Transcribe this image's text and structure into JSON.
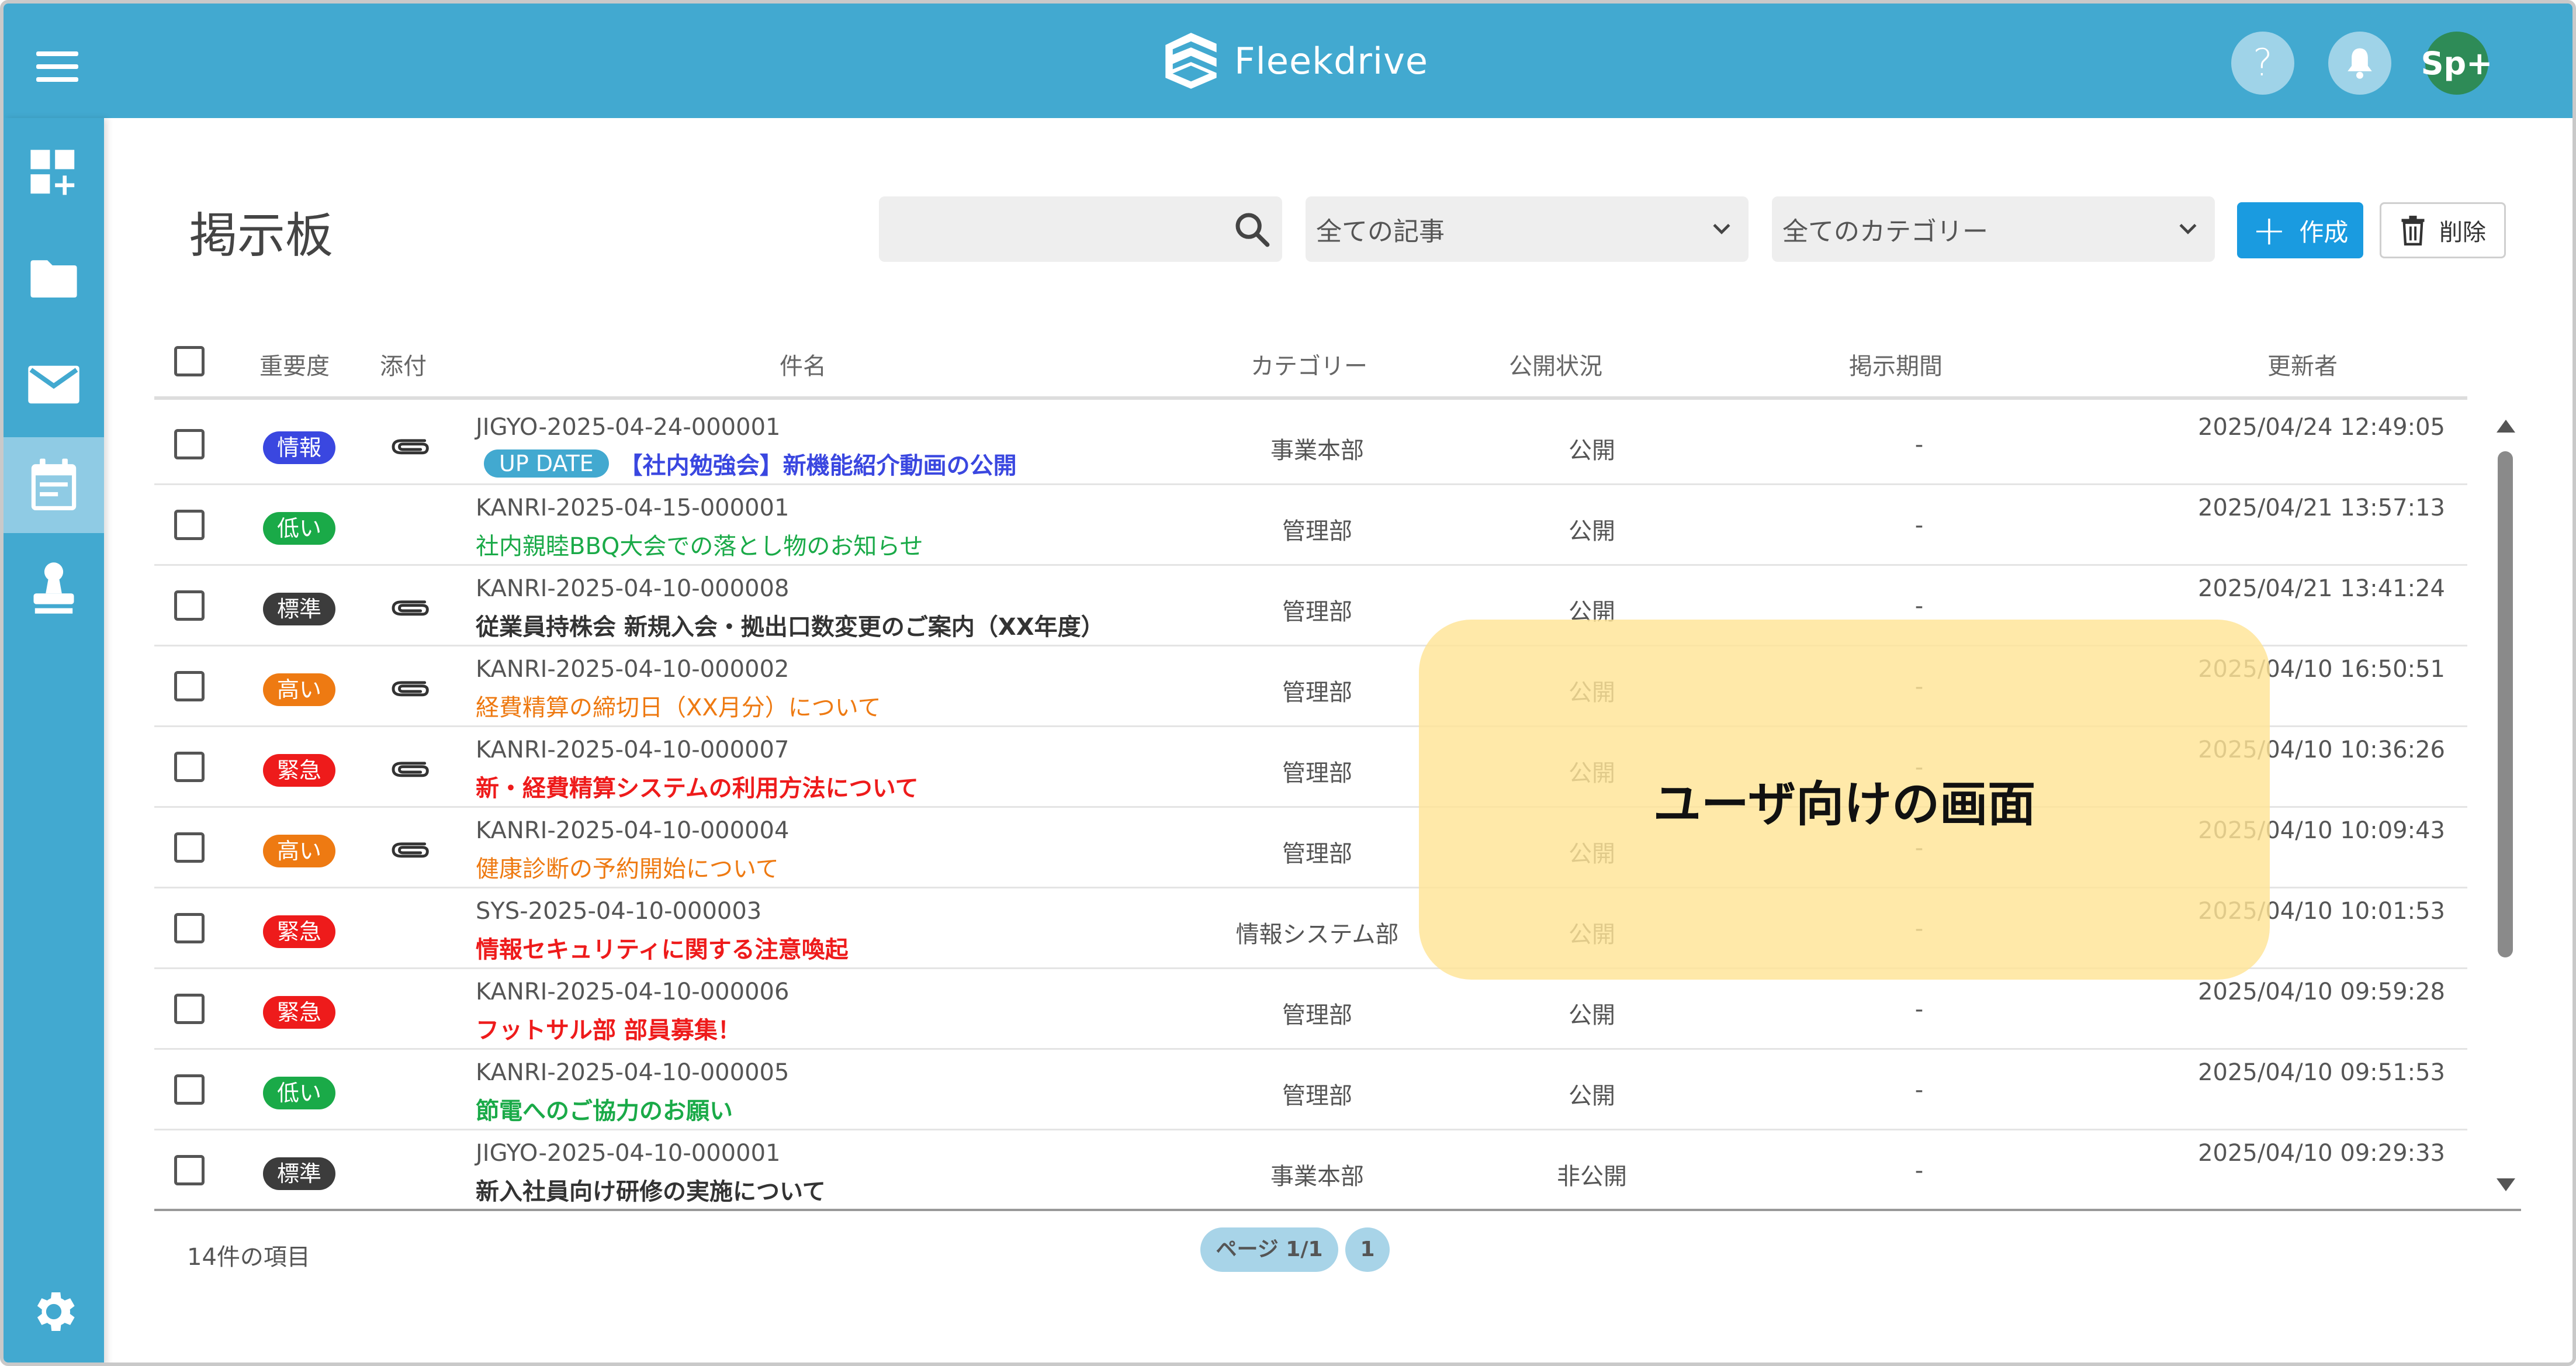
{
  "app": {
    "name": "Fleekdrive",
    "avatar_label": "Sp+",
    "help_label": "?"
  },
  "sidebar": {
    "items": [
      {
        "icon": "dashboard-add-icon"
      },
      {
        "icon": "folder-icon"
      },
      {
        "icon": "mail-icon"
      },
      {
        "icon": "calendar-board-icon",
        "active": true
      },
      {
        "icon": "stamp-icon"
      },
      {
        "icon": "gear-icon"
      }
    ]
  },
  "page": {
    "title": "掲示板",
    "search_placeholder": "",
    "filter_articles": "全ての記事",
    "filter_category": "全てのカテゴリー",
    "create_label": "作成",
    "delete_label": "削除"
  },
  "table": {
    "columns": {
      "priority": "重要度",
      "attachment": "添付",
      "subject": "件名",
      "category": "カテゴリー",
      "status": "公開状況",
      "period": "掲示期間",
      "updated_by": "更新者"
    },
    "rows": [
      {
        "priority": "情報",
        "priority_color": "#3a47e0",
        "attachment": true,
        "code": "JIGYO-2025-04-24-000001",
        "update_tag": "UP DATE",
        "title": "【社内勉強会】新機能紹介動画の公開",
        "title_color": "#3a47e0",
        "bold": true,
        "category": "事業本部",
        "status": "公開",
        "period": "-",
        "updated": "2025/04/24 12:49:05"
      },
      {
        "priority": "低い",
        "priority_color": "#1aaa48",
        "attachment": false,
        "code": "KANRI-2025-04-15-000001",
        "update_tag": "",
        "title": "社内親睦BBQ大会での落とし物のお知らせ",
        "title_color": "#1aaa48",
        "bold": false,
        "category": "管理部",
        "status": "公開",
        "period": "-",
        "updated": "2025/04/21 13:57:13"
      },
      {
        "priority": "標準",
        "priority_color": "#3c3c3c",
        "attachment": true,
        "code": "KANRI-2025-04-10-000008",
        "update_tag": "",
        "title": "従業員持株会 新規入会・拠出口数変更のご案内（XX年度）",
        "title_color": "#333333",
        "bold": true,
        "category": "管理部",
        "status": "公開",
        "period": "-",
        "updated": "2025/04/21 13:41:24"
      },
      {
        "priority": "高い",
        "priority_color": "#ee7a12",
        "attachment": true,
        "code": "KANRI-2025-04-10-000002",
        "update_tag": "",
        "title": "経費精算の締切日（XX月分）について",
        "title_color": "#ee7a12",
        "bold": false,
        "category": "管理部",
        "status": "公開",
        "period": "-",
        "updated": "2025/04/10 16:50:51"
      },
      {
        "priority": "緊急",
        "priority_color": "#ee1b1b",
        "attachment": true,
        "code": "KANRI-2025-04-10-000007",
        "update_tag": "",
        "title": "新・経費精算システムの利用方法について",
        "title_color": "#ee1b1b",
        "bold": true,
        "category": "管理部",
        "status": "公開",
        "period": "-",
        "updated": "2025/04/10 10:36:26"
      },
      {
        "priority": "高い",
        "priority_color": "#ee7a12",
        "attachment": true,
        "code": "KANRI-2025-04-10-000004",
        "update_tag": "",
        "title": "健康診断の予約開始について",
        "title_color": "#ee7a12",
        "bold": false,
        "category": "管理部",
        "status": "公開",
        "period": "-",
        "updated": "2025/04/10 10:09:43"
      },
      {
        "priority": "緊急",
        "priority_color": "#ee1b1b",
        "attachment": false,
        "code": "SYS-2025-04-10-000003",
        "update_tag": "",
        "title": "情報セキュリティに関する注意喚起",
        "title_color": "#ee1b1b",
        "bold": true,
        "category": "情報システム部",
        "status": "公開",
        "period": "-",
        "updated": "2025/04/10 10:01:53"
      },
      {
        "priority": "緊急",
        "priority_color": "#ee1b1b",
        "attachment": false,
        "code": "KANRI-2025-04-10-000006",
        "update_tag": "",
        "title": "フットサル部 部員募集！",
        "title_color": "#ee1b1b",
        "bold": true,
        "category": "管理部",
        "status": "公開",
        "period": "-",
        "updated": "2025/04/10 09:59:28"
      },
      {
        "priority": "低い",
        "priority_color": "#1aaa48",
        "attachment": false,
        "code": "KANRI-2025-04-10-000005",
        "update_tag": "",
        "title": "節電へのご協力のお願い",
        "title_color": "#1aaa48",
        "bold": true,
        "category": "管理部",
        "status": "公開",
        "period": "-",
        "updated": "2025/04/10 09:51:53"
      },
      {
        "priority": "標準",
        "priority_color": "#3c3c3c",
        "attachment": false,
        "code": "JIGYO-2025-04-10-000001",
        "update_tag": "",
        "title": "新入社員向け研修の実施について",
        "title_color": "#333333",
        "bold": true,
        "category": "事業本部",
        "status": "非公開",
        "period": "-",
        "updated": "2025/04/10 09:29:33"
      }
    ]
  },
  "footer": {
    "item_count": "14件の項目",
    "page_label": "ページ 1/1",
    "page_number": "1"
  },
  "overlay": {
    "text": "ユーザ向けの画面"
  },
  "colors": {
    "header": "#42a9d0",
    "accent": "#1a9be0",
    "overlay": "#ffe496"
  }
}
